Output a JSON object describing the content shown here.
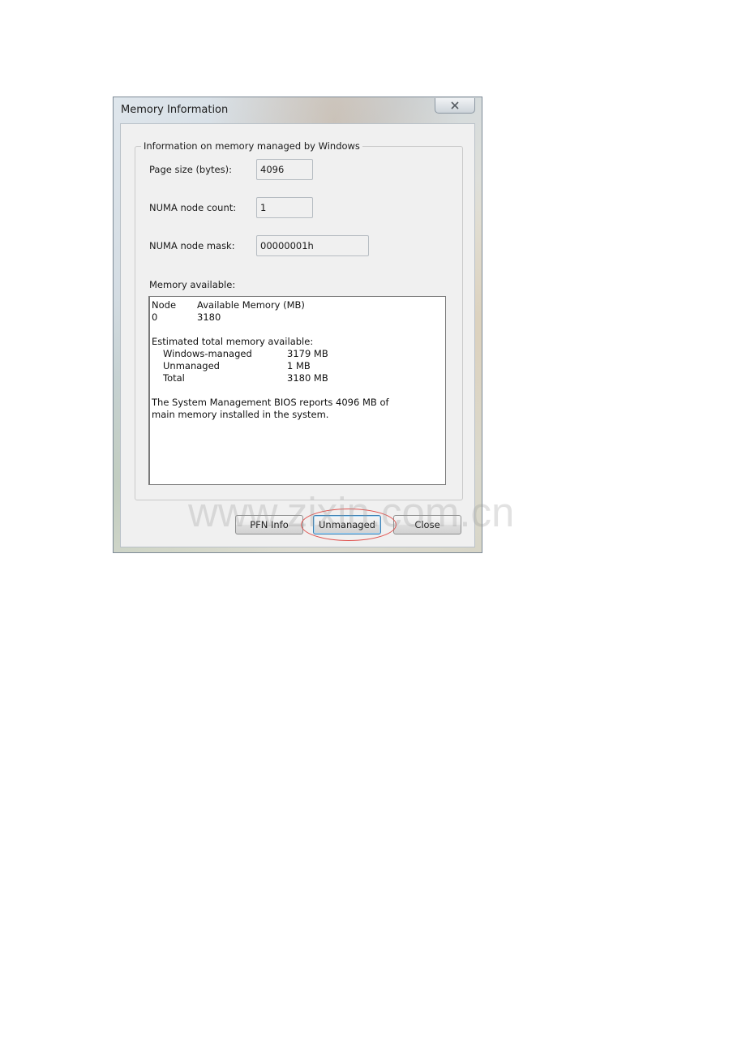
{
  "window": {
    "title": "Memory Information"
  },
  "group": {
    "legend": "Information on memory managed by Windows",
    "page_size_label": "Page size (bytes):",
    "page_size_value": "4096",
    "numa_count_label": "NUMA node count:",
    "numa_count_value": "1",
    "numa_mask_label": "NUMA node mask:",
    "numa_mask_value": "00000001h",
    "memory_label": "Memory available:"
  },
  "memory_text": {
    "header": {
      "node": "Node",
      "available": "Available Memory (MB)"
    },
    "rows": [
      {
        "node": "0",
        "available": "3180"
      }
    ],
    "estimated_title": "Estimated total memory available:",
    "totals": [
      {
        "label": "Windows-managed",
        "value": "3179 MB"
      },
      {
        "label": "Unmanaged",
        "value": "1 MB"
      },
      {
        "label": "Total",
        "value": "3180 MB"
      }
    ],
    "bios_line_1": "The System Management BIOS reports 4096 MB of",
    "bios_line_2": "main memory installed in the system."
  },
  "buttons": {
    "pfn_info": "PFN Info",
    "unmanaged": "Unmanaged",
    "close": "Close"
  },
  "watermark": "www.zixin.com.cn",
  "icons": {
    "close": "close-x-icon"
  },
  "colors": {
    "highlight": "#e0524e",
    "client_bg": "#f0f0f0"
  }
}
